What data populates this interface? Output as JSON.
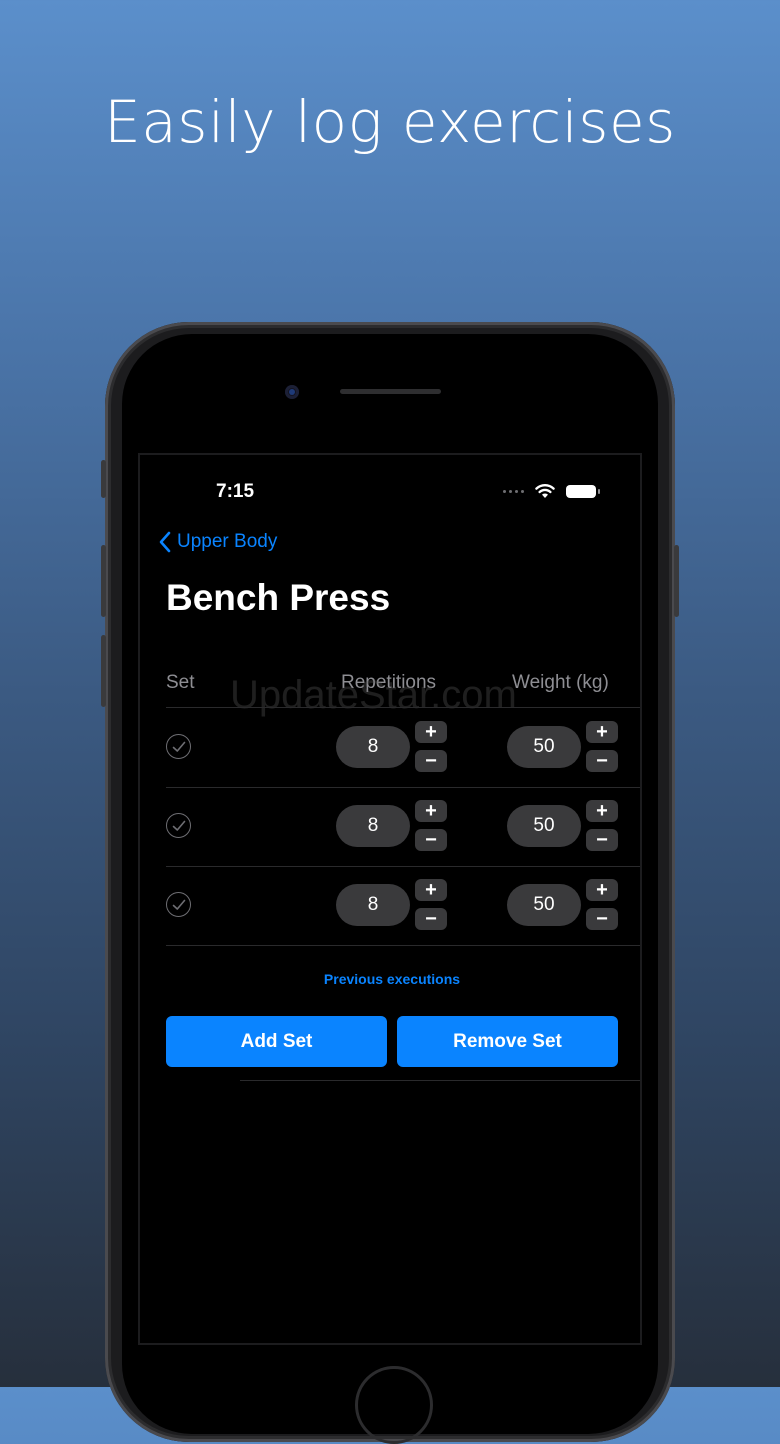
{
  "headline": "Easily log exercises",
  "status_bar": {
    "time": "7:15"
  },
  "nav": {
    "back_label": "Upper Body"
  },
  "page_title": "Bench Press",
  "table": {
    "headers": {
      "set": "Set",
      "reps": "Repetitions",
      "weight": "Weight (kg)"
    },
    "rows": [
      {
        "reps": "8",
        "weight": "50"
      },
      {
        "reps": "8",
        "weight": "50"
      },
      {
        "reps": "8",
        "weight": "50"
      }
    ]
  },
  "watermark": "UpdateStar.com",
  "previous_link": "Previous executions",
  "buttons": {
    "add": "Add Set",
    "remove": "Remove Set"
  },
  "stepper": {
    "plus": "+",
    "minus": "−"
  },
  "colors": {
    "accent": "#0a84ff",
    "background": "#000000"
  },
  "icons": {
    "back": "chevron-left-icon",
    "check": "checkmark-circle-icon",
    "wifi": "wifi-icon",
    "battery": "battery-icon"
  }
}
